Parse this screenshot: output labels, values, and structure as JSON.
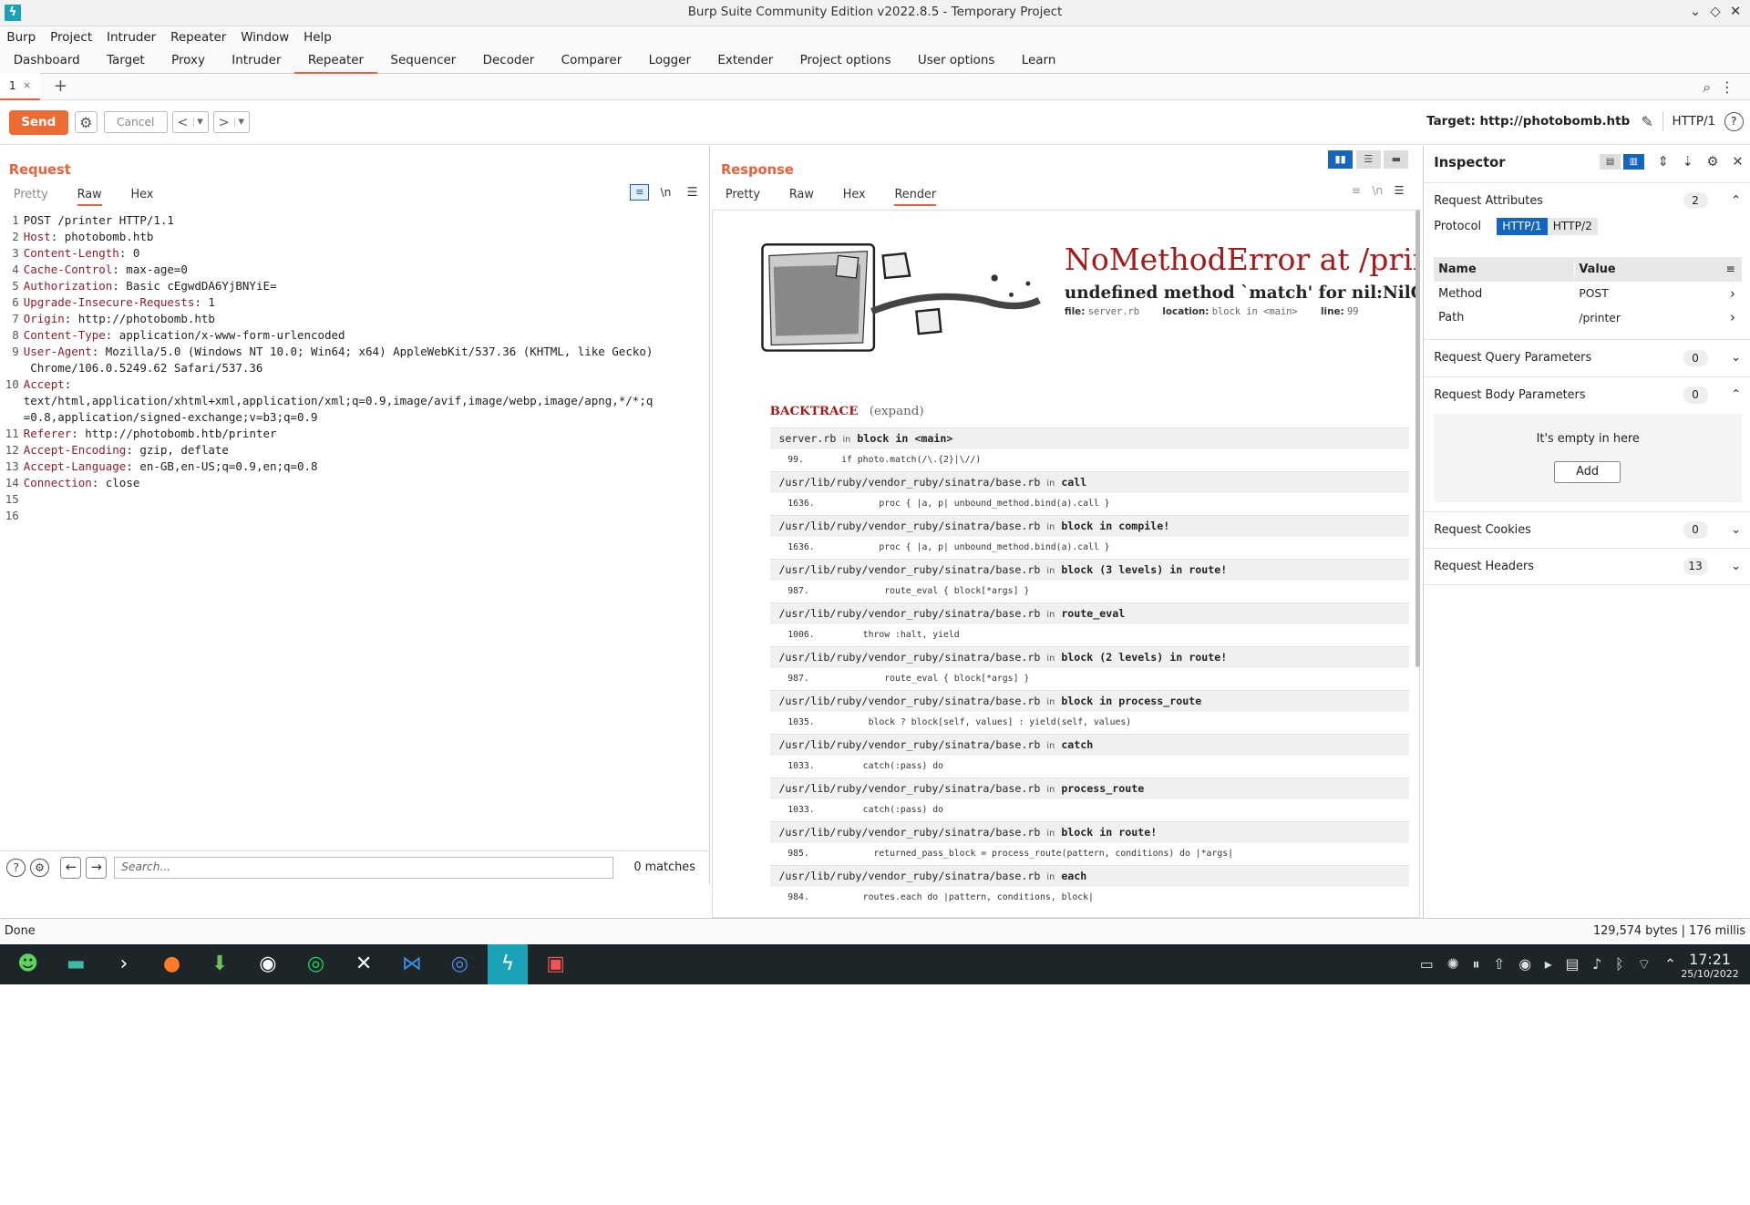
{
  "window": {
    "title": "Burp Suite Community Edition v2022.8.5 - Temporary Project"
  },
  "menu": [
    "Burp",
    "Project",
    "Intruder",
    "Repeater",
    "Window",
    "Help"
  ],
  "tabs": [
    "Dashboard",
    "Target",
    "Proxy",
    "Intruder",
    "Repeater",
    "Sequencer",
    "Decoder",
    "Comparer",
    "Logger",
    "Extender",
    "Project options",
    "User options",
    "Learn"
  ],
  "active_tab": "Repeater",
  "repeater_tab": {
    "label": "1",
    "close": "×"
  },
  "toolbar": {
    "send": "Send",
    "cancel": "Cancel",
    "target_label": "Target: http://photobomb.htb",
    "protocol": "HTTP/1"
  },
  "request": {
    "title": "Request",
    "subtabs": [
      "Pretty",
      "Raw",
      "Hex"
    ],
    "wrap_icon": "wrap-icon",
    "newline_toggle": "\\n",
    "lines": [
      {
        "n": "1",
        "key": "",
        "text": "POST /printer HTTP/1.1"
      },
      {
        "n": "2",
        "key": "Host",
        "text": ": photobomb.htb"
      },
      {
        "n": "3",
        "key": "Content-Length",
        "text": ": 0"
      },
      {
        "n": "4",
        "key": "Cache-Control",
        "text": ": max-age=0"
      },
      {
        "n": "5",
        "key": "Authorization",
        "text": ": Basic cEgwdDA6YjBNYiE="
      },
      {
        "n": "6",
        "key": "Upgrade-Insecure-Requests",
        "text": ": 1"
      },
      {
        "n": "7",
        "key": "Origin",
        "text": ": http://photobomb.htb"
      },
      {
        "n": "8",
        "key": "Content-Type",
        "text": ": application/x-www-form-urlencoded"
      },
      {
        "n": "9",
        "key": "User-Agent",
        "text": ": Mozilla/5.0 (Windows NT 10.0; Win64; x64) AppleWebKit/537.36 (KHTML, like Gecko)"
      },
      {
        "n": "",
        "key": "",
        "text": " Chrome/106.0.5249.62 Safari/537.36"
      },
      {
        "n": "10",
        "key": "Accept",
        "text": ":"
      },
      {
        "n": "",
        "key": "",
        "text": "text/html,application/xhtml+xml,application/xml;q=0.9,image/avif,image/webp,image/apng,*/*;q"
      },
      {
        "n": "",
        "key": "",
        "text": "=0.8,application/signed-exchange;v=b3;q=0.9"
      },
      {
        "n": "11",
        "key": "Referer",
        "text": ": http://photobomb.htb/printer"
      },
      {
        "n": "12",
        "key": "Accept-Encoding",
        "text": ": gzip, deflate"
      },
      {
        "n": "13",
        "key": "Accept-Language",
        "text": ": en-GB,en-US;q=0.9,en;q=0.8"
      },
      {
        "n": "14",
        "key": "Connection",
        "text": ": close"
      },
      {
        "n": "15",
        "key": "",
        "text": ""
      },
      {
        "n": "16",
        "key": "",
        "text": ""
      }
    ],
    "search_placeholder": "Search...",
    "matches": "0 matches"
  },
  "response": {
    "title": "Response",
    "subtabs": [
      "Pretty",
      "Raw",
      "Hex",
      "Render"
    ],
    "error_title": "NoMethodError at /printer",
    "error_sub": "undefined method `match' for nil:NilClass",
    "meta": {
      "file_label": "file:",
      "file": "server.rb",
      "location_label": "location:",
      "location": "block in <main>",
      "line_label": "line:",
      "line": "99"
    },
    "backtrace_title": "BACKTRACE",
    "backtrace_expand": "(expand)",
    "frames": [
      {
        "file": "server.rb",
        "in": "in",
        "fn": "block in <main>",
        "code": "99.       if photo.match(/\\.{2}|\\//)"
      },
      {
        "file": "/usr/lib/ruby/vendor_ruby/sinatra/base.rb",
        "in": "in",
        "fn": "call",
        "code": "1636.            proc { |a, p| unbound_method.bind(a).call }"
      },
      {
        "file": "/usr/lib/ruby/vendor_ruby/sinatra/base.rb",
        "in": "in",
        "fn": "block in compile!",
        "code": "1636.            proc { |a, p| unbound_method.bind(a).call }"
      },
      {
        "file": "/usr/lib/ruby/vendor_ruby/sinatra/base.rb",
        "in": "in",
        "fn": "block (3 levels) in route!",
        "code": "987.              route_eval { block[*args] }"
      },
      {
        "file": "/usr/lib/ruby/vendor_ruby/sinatra/base.rb",
        "in": "in",
        "fn": "route_eval",
        "code": "1006.         throw :halt, yield"
      },
      {
        "file": "/usr/lib/ruby/vendor_ruby/sinatra/base.rb",
        "in": "in",
        "fn": "block (2 levels) in route!",
        "code": "987.              route_eval { block[*args] }"
      },
      {
        "file": "/usr/lib/ruby/vendor_ruby/sinatra/base.rb",
        "in": "in",
        "fn": "block in process_route",
        "code": "1035.          block ? block[self, values] : yield(self, values)"
      },
      {
        "file": "/usr/lib/ruby/vendor_ruby/sinatra/base.rb",
        "in": "in",
        "fn": "catch",
        "code": "1033.         catch(:pass) do"
      },
      {
        "file": "/usr/lib/ruby/vendor_ruby/sinatra/base.rb",
        "in": "in",
        "fn": "process_route",
        "code": "1033.         catch(:pass) do"
      },
      {
        "file": "/usr/lib/ruby/vendor_ruby/sinatra/base.rb",
        "in": "in",
        "fn": "block in route!",
        "code": "985.            returned_pass_block = process_route(pattern, conditions) do |*args|"
      },
      {
        "file": "/usr/lib/ruby/vendor_ruby/sinatra/base.rb",
        "in": "in",
        "fn": "each",
        "code": "984.          routes.each do |pattern, conditions, block|"
      }
    ]
  },
  "inspector": {
    "title": "Inspector",
    "sections": [
      {
        "label": "Request Attributes",
        "count": "2",
        "open": true
      },
      {
        "label": "Request Query Parameters",
        "count": "0",
        "open": false
      },
      {
        "label": "Request Body Parameters",
        "count": "0",
        "open": true
      },
      {
        "label": "Request Cookies",
        "count": "0",
        "open": false
      },
      {
        "label": "Request Headers",
        "count": "13",
        "open": false
      }
    ],
    "protocol_label": "Protocol",
    "protocols": [
      "HTTP/1",
      "HTTP/2"
    ],
    "table": {
      "name": "Name",
      "value": "Value",
      "rows": [
        {
          "name": "Method",
          "value": "POST"
        },
        {
          "name": "Path",
          "value": "/printer"
        }
      ]
    },
    "empty_text": "It's empty in here",
    "add": "Add"
  },
  "status": {
    "left": "Done",
    "right": "129,574 bytes | 176 millis"
  },
  "clock": {
    "time": "17:21",
    "date": "25/10/2022"
  },
  "colors": {
    "accent": "#e8613a",
    "blue": "#1565c0",
    "error": "#a31c1c"
  }
}
